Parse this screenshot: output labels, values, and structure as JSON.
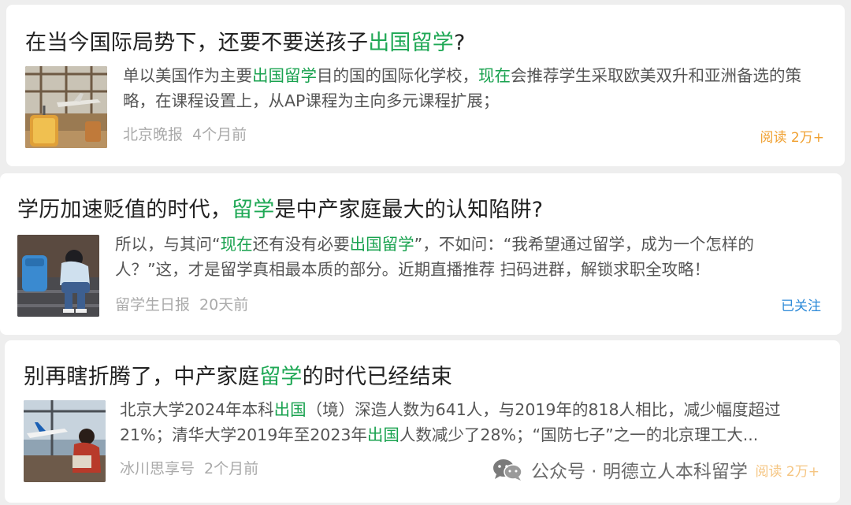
{
  "articles": [
    {
      "title_pre": "在当今国际局势下，还要不要送孩子",
      "title_hl": "出国留学",
      "title_post": "?",
      "summary": [
        {
          "t": "单以美国作为主要",
          "h": false
        },
        {
          "t": "出国留学",
          "h": true
        },
        {
          "t": "目的国的国际化学校，",
          "h": false
        },
        {
          "t": "现在",
          "h": true
        },
        {
          "t": "会推荐学生采取欧美双升和亚洲备选的策略，在课程设置上，从AP课程为主向多元课程扩展；",
          "h": false
        }
      ],
      "source": "北京晚报",
      "time": "4个月前",
      "tag": "阅读 2万+",
      "thumbnail_icon": "airport-suitcase-image"
    },
    {
      "title_pre": "学历加速贬值的时代，",
      "title_hl": "留学",
      "title_post": "是中产家庭最大的认知陷阱?",
      "summary": [
        {
          "t": "所以，与其问“",
          "h": false
        },
        {
          "t": "现在",
          "h": true
        },
        {
          "t": "还有没有必要",
          "h": false
        },
        {
          "t": "出国留学",
          "h": true
        },
        {
          "t": "”，不如问：“我希望通过留学，成为一个怎样的人？”这，才是留学真相最本质的部分。近期直播推荐 扫码进群，解锁求职全攻略！",
          "h": false
        }
      ],
      "source": "留学生日报",
      "time": "20天前",
      "tag": "已关注",
      "thumbnail_icon": "sad-student-image"
    },
    {
      "title_pre": "别再瞎折腾了，中产家庭",
      "title_hl": "留学",
      "title_post": "的时代已经结束",
      "summary": [
        {
          "t": "北京大学2024年本科",
          "h": false
        },
        {
          "t": "出国",
          "h": true
        },
        {
          "t": "（境）深造人数为641人，与2019年的818人相比，减少幅度超过21%；清华大学2019年至2023年",
          "h": false
        },
        {
          "t": "出国",
          "h": true
        },
        {
          "t": "人数减少了28%；“国防七子”之一的北京理工大...",
          "h": false
        }
      ],
      "source": "冰川思享号",
      "time": "2个月前",
      "tag": "阅读 2万+",
      "thumbnail_icon": "airplane-window-image"
    }
  ],
  "watermark": {
    "text": "公众号 · 明德立人本科留学",
    "icon": "wechat-icon"
  },
  "colors": {
    "highlight": "#1fa855",
    "read_count": "#f0a030",
    "followed": "#2d8ad8",
    "meta": "#aaaaaa"
  }
}
